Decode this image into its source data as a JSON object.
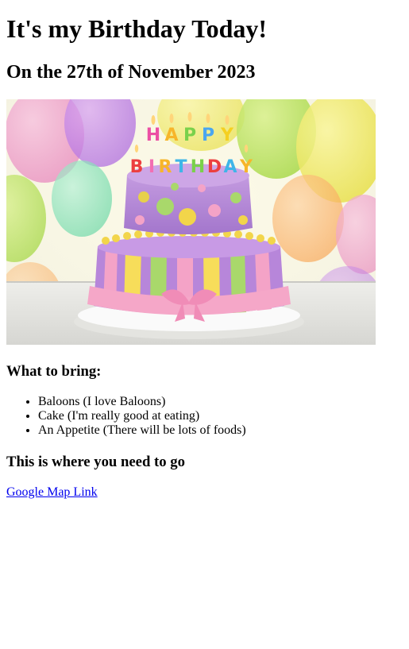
{
  "heading": "It's my Birthday Today!",
  "date_heading": "On the 27th of November 2023",
  "image": {
    "candle_letters": [
      "H",
      "A",
      "P",
      "P",
      "Y",
      "B",
      "I",
      "R",
      "T",
      "H",
      "D",
      "A",
      "Y"
    ]
  },
  "bring": {
    "title": "What to bring:",
    "items": [
      "Baloons (I love Baloons)",
      "Cake (I'm really good at eating)",
      "An Appetite (There will be lots of foods)"
    ]
  },
  "location": {
    "title": "This is where you need to go",
    "link_text": "Google Map Link"
  },
  "colors": {
    "link": "#0000ee",
    "text": "#000000",
    "background": "#ffffff"
  }
}
